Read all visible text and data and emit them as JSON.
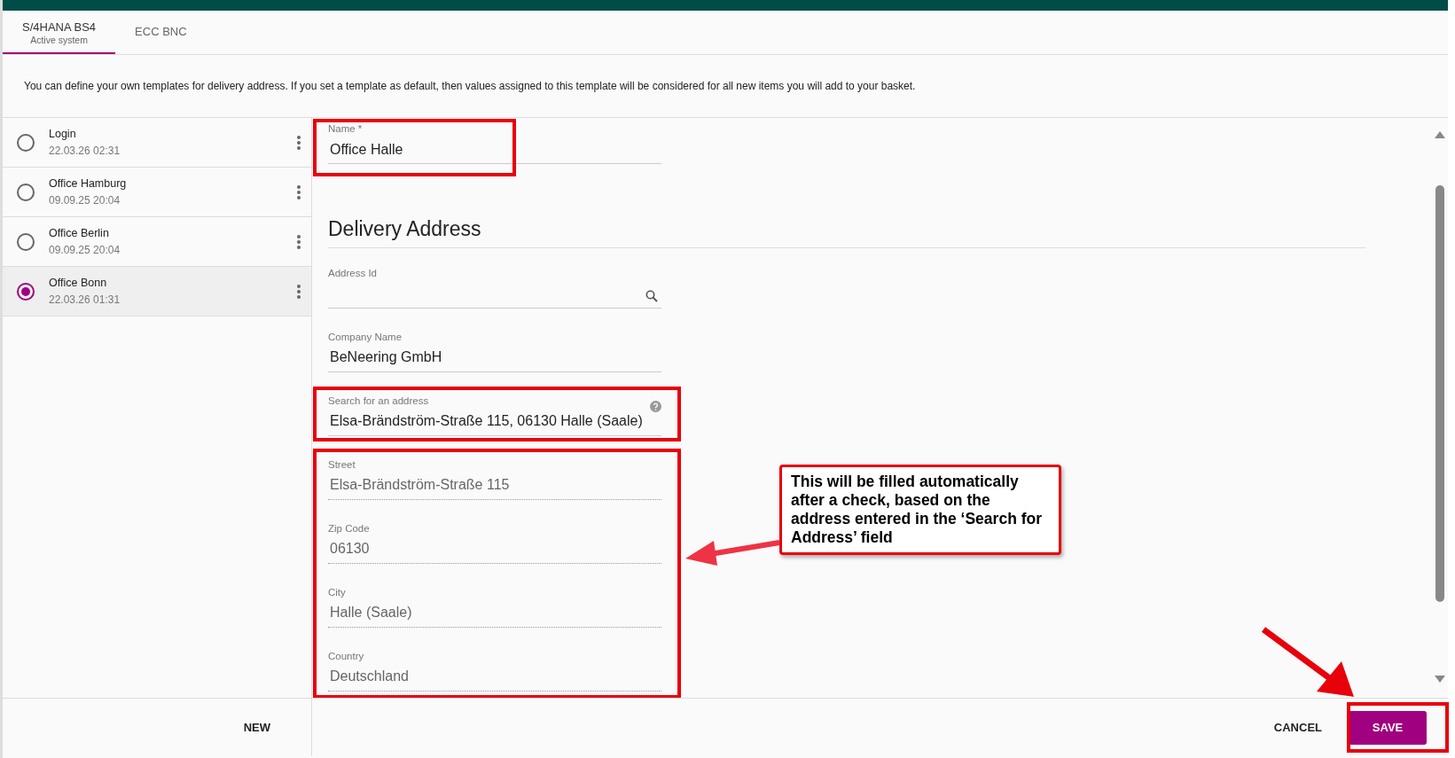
{
  "tabs": [
    {
      "label": "S/4HANA BS4",
      "sublabel": "Active system",
      "selected": true
    },
    {
      "label": "ECC BNC",
      "selected": false
    }
  ],
  "description": "You can define your own templates for delivery address. If you set a template as default, then values assigned to this template will be considered for all new items you will add to your basket.",
  "templates": [
    {
      "name": "Login",
      "date": "22.03.26 02:31",
      "selected": false
    },
    {
      "name": "Office Hamburg",
      "date": "09.09.25 20:04",
      "selected": false
    },
    {
      "name": "Office Berlin",
      "date": "09.09.25 20:04",
      "selected": false
    },
    {
      "name": "Office Bonn",
      "date": "22.03.26 01:31",
      "selected": true
    }
  ],
  "form": {
    "name_field": {
      "label": "Name *",
      "value": "Office Halle"
    },
    "section_title": "Delivery Address",
    "fields": [
      {
        "label": "Address Id",
        "kind": "search"
      },
      {
        "label": "Company Name",
        "value": "BeNeering GmbH",
        "kind": "text"
      },
      {
        "label": "Search for an address",
        "value": "Elsa-Brändström-Straße 115, 06130 Halle (Saale)",
        "kind": "help"
      },
      {
        "label": "Street",
        "value": "Elsa-Brändström-Straße 115",
        "kind": "readonly"
      },
      {
        "label": "Zip Code",
        "value": "06130",
        "kind": "readonly"
      },
      {
        "label": "City",
        "value": "Halle (Saale)",
        "kind": "readonly"
      },
      {
        "label": "Country",
        "value": "Deutschland",
        "kind": "readonly"
      }
    ]
  },
  "footer": {
    "new_button": "NEW",
    "cancel_button": "CANCEL",
    "save_button": "SAVE"
  },
  "annotation": {
    "callout": "This will be filled automatically after a check, based on the address entered in the ‘Search for Address’ field"
  }
}
